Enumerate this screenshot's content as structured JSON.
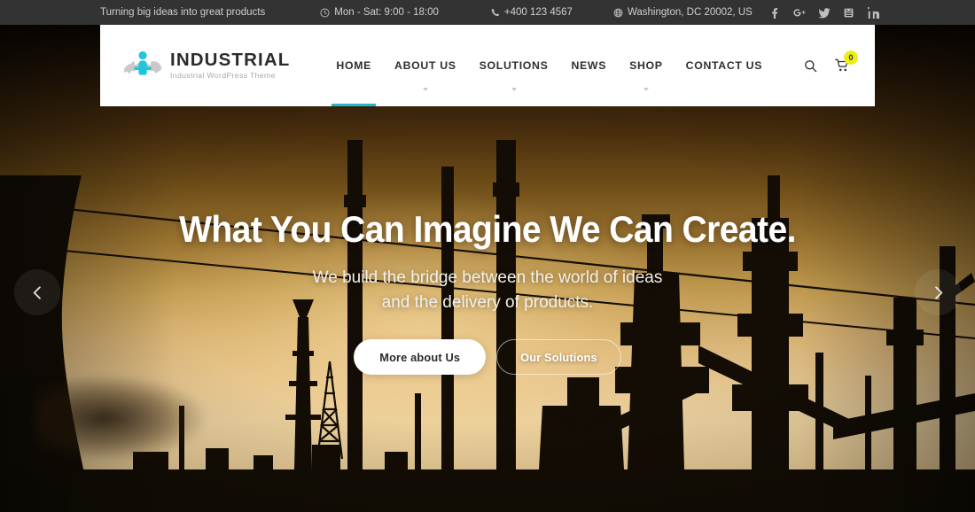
{
  "topbar": {
    "tagline": "Turning big ideas into great products",
    "hours": "Mon - Sat: 9:00 - 18:00",
    "phone": "+400 123 4567",
    "address": "Washington, DC 20002, US",
    "icons": {
      "hours": "clock-icon",
      "phone": "phone-icon",
      "address": "globe-icon"
    },
    "socials": [
      {
        "name": "facebook-icon",
        "label": "Facebook"
      },
      {
        "name": "google-plus-icon",
        "label": "Google Plus"
      },
      {
        "name": "twitter-icon",
        "label": "Twitter"
      },
      {
        "name": "youtube-icon",
        "label": "YouTube"
      },
      {
        "name": "linkedin-icon",
        "label": "LinkedIn"
      }
    ],
    "background_color": "#333333",
    "text_color": "#cfcfcf"
  },
  "header": {
    "logo": {
      "title": "INDUSTRIAL",
      "subtitle": "Industrial WordPress Theme",
      "mark_name": "industrial-gear-figure-logo",
      "accent_color": "#1fc3dd",
      "gear_color": "#c9c9c9"
    },
    "nav": [
      {
        "label": "HOME",
        "active": true,
        "has_dropdown": false
      },
      {
        "label": "ABOUT US",
        "active": false,
        "has_dropdown": true
      },
      {
        "label": "SOLUTIONS",
        "active": false,
        "has_dropdown": true
      },
      {
        "label": "NEWS",
        "active": false,
        "has_dropdown": false
      },
      {
        "label": "SHOP",
        "active": false,
        "has_dropdown": true
      },
      {
        "label": "CONTACT US",
        "active": false,
        "has_dropdown": false
      }
    ],
    "active_underline_color": "#2ab5c4",
    "search_icon": "search-icon",
    "cart_icon": "shopping-cart-icon",
    "cart_count": "0",
    "cart_badge_color": "#ecee16",
    "background_color": "#ffffff"
  },
  "hero": {
    "title": "What You Can Imagine We Can Create.",
    "subtitle_line1": "We build the bridge between the world of ideas",
    "subtitle_line2": "and the delivery of products.",
    "buttons": {
      "primary": "More about Us",
      "secondary": "Our Solutions"
    },
    "prev_arrow": "chevron-left-icon",
    "next_arrow": "chevron-right-icon",
    "sky_top_color": "#000000",
    "sky_bottom_color": "#e9cf9e",
    "silhouette_color": "#120c05"
  }
}
